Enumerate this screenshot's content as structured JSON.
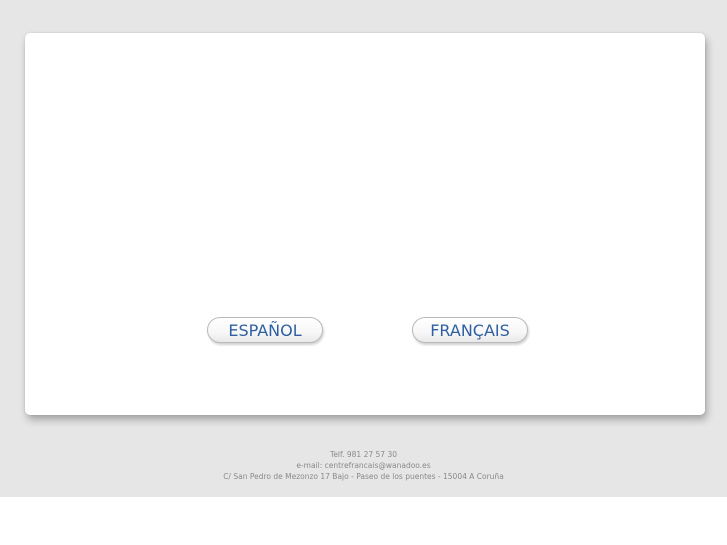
{
  "languages": {
    "spanish_label": "ESPAÑOL",
    "french_label": "FRANÇAIS"
  },
  "footer": {
    "phone": "Telf. 981 27 57 30",
    "email": "e-mail: centrefrancais@wanadoo.es",
    "address": "C/ San Pedro de Mezonzo 17 Bajo - Paseo de los puentes - 15004 A Coruña"
  },
  "colors": {
    "background": "#e6e6e6",
    "card": "#ffffff",
    "button_text": "#2e5fa3",
    "footer_text": "#8a8a8a"
  }
}
